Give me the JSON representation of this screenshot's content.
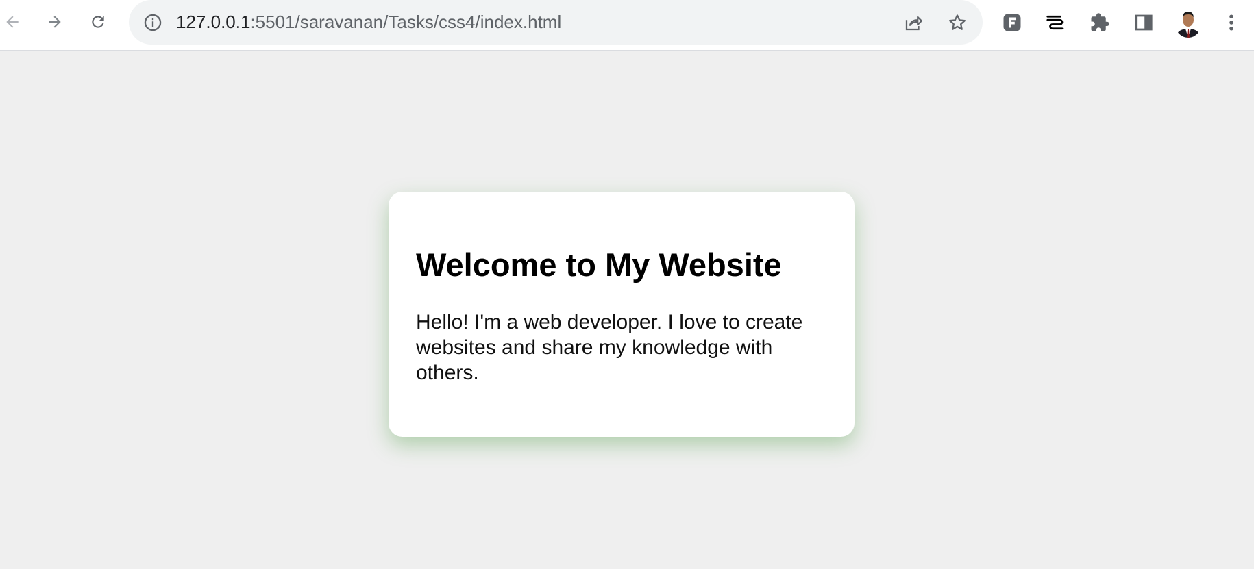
{
  "browser": {
    "url_host": "127.0.0.1",
    "url_rest": ":5501/saravanan/Tasks/css4/index.html",
    "icons": {
      "back": "back-arrow-icon",
      "forward": "forward-arrow-icon",
      "reload": "reload-icon",
      "site_info": "info-icon",
      "share": "share-icon",
      "bookmark": "star-icon",
      "extension_1": "extension-icon",
      "extension_2": "extension-icon",
      "extensions_menu": "puzzle-icon",
      "side_panel": "side-panel-icon",
      "profile": "avatar",
      "menu": "more-vertical-icon"
    },
    "colors": {
      "toolbar": "#ffffff",
      "omnibox": "#f1f3f4",
      "icon": "#5f6368"
    }
  },
  "page": {
    "background": "#efefef",
    "card": {
      "title": "Welcome to My Website",
      "text": "Hello! I'm a web developer. I love to create websites and share my knowledge with others.",
      "shadow_color": "#3c9632"
    }
  }
}
